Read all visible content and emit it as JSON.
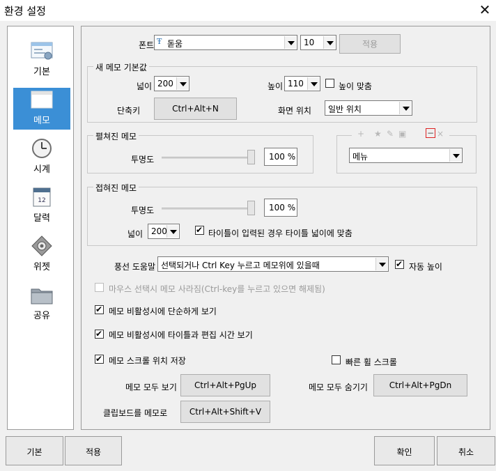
{
  "window": {
    "title": "환경 설정"
  },
  "sidebar": {
    "items": [
      {
        "label": "기본",
        "icon": "window-settings-icon",
        "active": false
      },
      {
        "label": "메모",
        "icon": "memo-window-icon",
        "active": true
      },
      {
        "label": "시계",
        "icon": "clock-icon",
        "active": false
      },
      {
        "label": "달력",
        "icon": "calendar-icon",
        "active": false
      },
      {
        "label": "위젯",
        "icon": "widget-gear-icon",
        "active": false
      },
      {
        "label": "공유",
        "icon": "folder-share-icon",
        "active": false
      }
    ]
  },
  "font": {
    "label": "폰트",
    "value": "돋움",
    "size": "10",
    "apply_label": "적용"
  },
  "new_memo": {
    "group_label": "새 메모 기본값",
    "width_label": "넓이",
    "width_value": "200",
    "height_label": "높이",
    "height_value": "110",
    "fit_height_label": "높이 맞춤",
    "shortcut_label": "단축키",
    "shortcut_value": "Ctrl+Alt+N",
    "position_label": "화면 위치",
    "position_value": "일반 위치"
  },
  "expanded": {
    "group_label": "펼쳐진 메모",
    "opacity_label": "투명도",
    "opacity_value": "100 %",
    "opacity_fraction": 1.0
  },
  "menu_preview": {
    "toolbar_icons": [
      "+",
      "★",
      "✎",
      "▣",
      "−",
      "×"
    ],
    "menu_value": "메뉴"
  },
  "collapsed": {
    "group_label": "접혀진 메모",
    "opacity_label": "투명도",
    "opacity_value": "100 %",
    "opacity_fraction": 1.0,
    "width_label": "넓이",
    "width_value": "200",
    "fit_title_label": "타이틀이 입력된 경우 타이틀 넓이에 맞춤"
  },
  "balloon": {
    "label": "풍선 도움말",
    "value": "선택되거나 Ctrl Key 누르고  메모위에 있을때",
    "auto_height_label": "자동 높이"
  },
  "options": {
    "mouse_hide_label": "마우스 선택시 메모 사라짐(Ctrl-key를 누르고 있으면 해제됨)",
    "simple_inactive_label": "메모 비활성시에 단순하게 보기",
    "inactive_title_label": "메모 비활성시에 타이틀과 편집 시간 보기",
    "save_scroll_label": "메모 스크롤 위치 저장",
    "fast_scroll_label": "빠른 휠 스크롤"
  },
  "hotkeys": {
    "show_all_label": "메모 모두 보기",
    "show_all_value": "Ctrl+Alt+PgUp",
    "hide_all_label": "메모 모두 숨기기",
    "hide_all_value": "Ctrl+Alt+PgDn",
    "clipboard_label": "클립보드를 메모로",
    "clipboard_value": "Ctrl+Alt+Shift+V"
  },
  "footer": {
    "default_label": "기본",
    "apply_label": "적용",
    "ok_label": "확인",
    "cancel_label": "취소"
  },
  "colors": {
    "accent": "#3b8fd6",
    "window_bg": "#f0f0f0",
    "border": "#9a9a9a"
  }
}
